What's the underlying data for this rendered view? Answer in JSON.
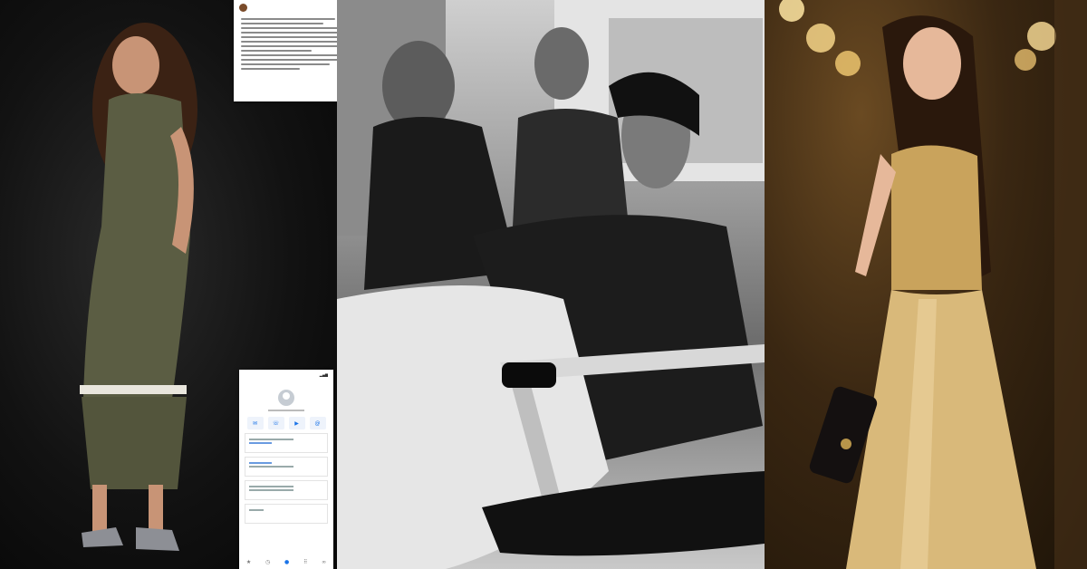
{
  "panels": {
    "left": "",
    "center": "",
    "right": ""
  },
  "post_screenshot": {
    "author": "",
    "more_icon": "ellipsis-icon"
  },
  "phone_screenshot": {
    "time": "",
    "contact_name": "",
    "action_icons": [
      "message-icon",
      "call-icon",
      "video-icon",
      "email-icon"
    ],
    "tab_icons": [
      "star-icon",
      "clock-icon",
      "contacts-icon",
      "keypad-icon",
      "voicemail-icon"
    ]
  }
}
